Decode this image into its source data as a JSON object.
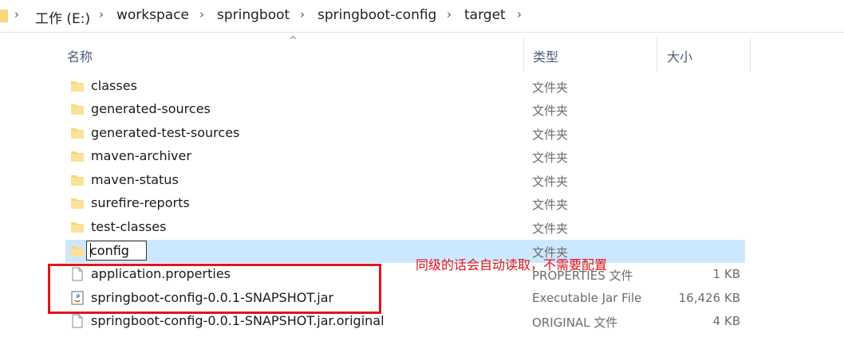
{
  "breadcrumb": {
    "items": [
      "工作 (E:)",
      "workspace",
      "springboot",
      "springboot-config",
      "target"
    ]
  },
  "columns": {
    "name": "名称",
    "type": "类型",
    "size": "大小"
  },
  "files": [
    {
      "name": "classes",
      "type": "文件夹",
      "size": "",
      "icon": "folder-icon"
    },
    {
      "name": "generated-sources",
      "type": "文件夹",
      "size": "",
      "icon": "folder-icon"
    },
    {
      "name": "generated-test-sources",
      "type": "文件夹",
      "size": "",
      "icon": "folder-icon"
    },
    {
      "name": "maven-archiver",
      "type": "文件夹",
      "size": "",
      "icon": "folder-icon"
    },
    {
      "name": "maven-status",
      "type": "文件夹",
      "size": "",
      "icon": "folder-icon"
    },
    {
      "name": "surefire-reports",
      "type": "文件夹",
      "size": "",
      "icon": "folder-icon"
    },
    {
      "name": "test-classes",
      "type": "文件夹",
      "size": "",
      "icon": "folder-icon"
    },
    {
      "name": "config",
      "type": "文件夹",
      "size": "",
      "icon": "folder-icon",
      "renaming": true
    },
    {
      "name": "application.properties",
      "type": "PROPERTIES 文件",
      "size": "1 KB",
      "icon": "file-icon"
    },
    {
      "name": "springboot-config-0.0.1-SNAPSHOT.jar",
      "type": "Executable Jar File",
      "size": "16,426 KB",
      "icon": "jar-icon"
    },
    {
      "name": "springboot-config-0.0.1-SNAPSHOT.jar.original",
      "type": "ORIGINAL 文件",
      "size": "4 KB",
      "icon": "file-icon"
    }
  ],
  "annotation": {
    "text": "同级的话会自动读取，不需要配置",
    "color": "#e0141e"
  },
  "colors": {
    "selection": "#cce8ff",
    "folder": "#f8d775",
    "header_text": "#4a5e7a"
  }
}
